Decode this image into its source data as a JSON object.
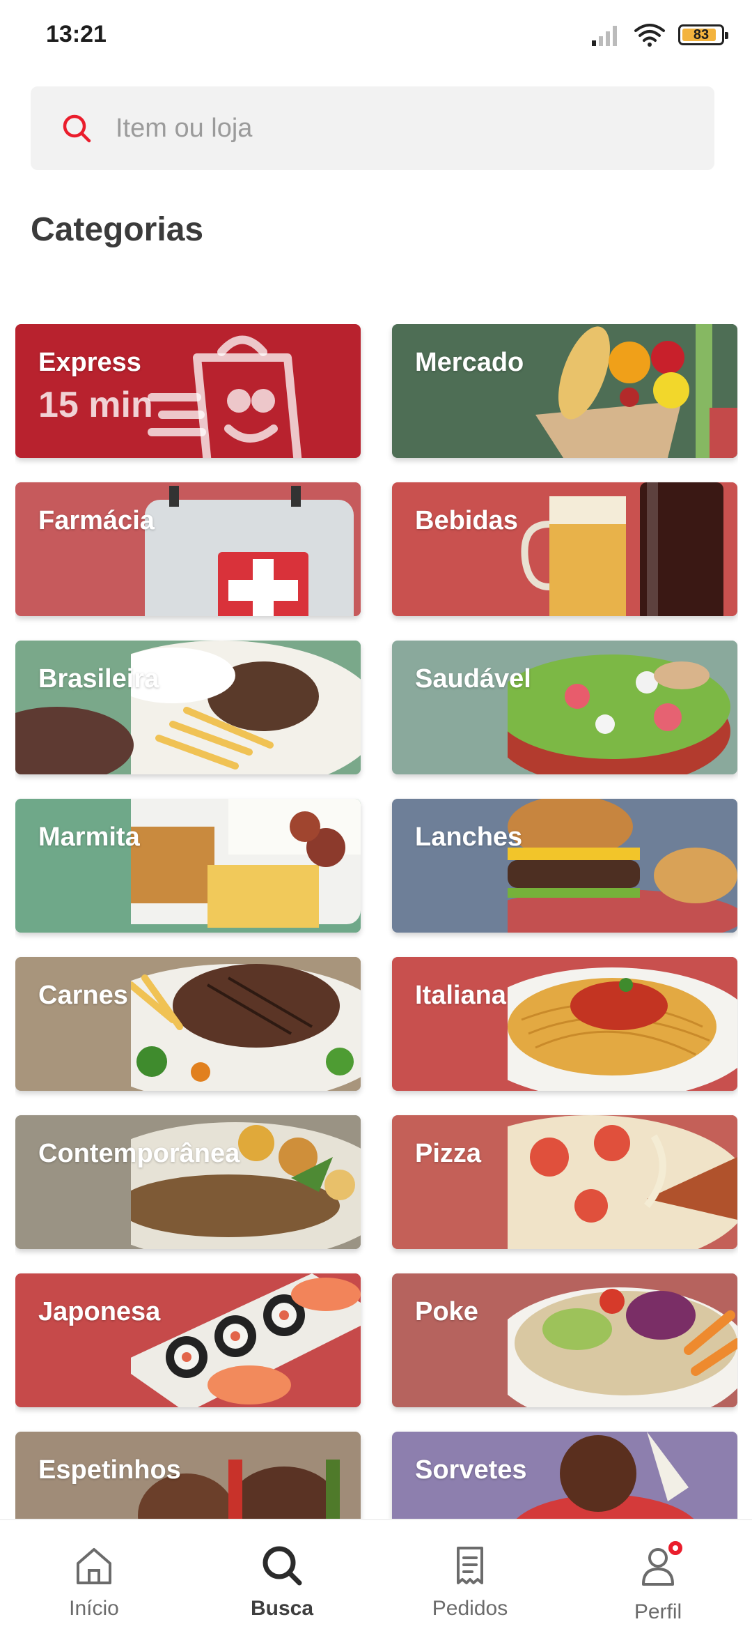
{
  "status_bar": {
    "time": "13:21",
    "battery": "83"
  },
  "search": {
    "placeholder": "Item ou loja",
    "value": ""
  },
  "section_title": "Categorias",
  "categories": [
    {
      "label": "Express",
      "sub": "15 min",
      "color": "#b8222e"
    },
    {
      "label": "Mercado",
      "color": "#4e6e55"
    },
    {
      "label": "Farmácia",
      "color": "#c65a5c"
    },
    {
      "label": "Bebidas",
      "color": "#c9514f"
    },
    {
      "label": "Brasileira",
      "color": "#7aa88a"
    },
    {
      "label": "Saudável",
      "color": "#8aa99c"
    },
    {
      "label": "Marmita",
      "color": "#6fa889"
    },
    {
      "label": "Lanches",
      "color": "#6e7f98"
    },
    {
      "label": "Carnes",
      "color": "#a8957c"
    },
    {
      "label": "Italiana",
      "color": "#c8504e"
    },
    {
      "label": "Contemporânea",
      "color": "#9a9384"
    },
    {
      "label": "Pizza",
      "color": "#c46058"
    },
    {
      "label": "Japonesa",
      "color": "#c64a4a"
    },
    {
      "label": "Poke",
      "color": "#b6635e"
    },
    {
      "label": "Espetinhos",
      "color": "#a08c78"
    },
    {
      "label": "Sorvetes",
      "color": "#8d7fae"
    }
  ],
  "nav": {
    "items": [
      {
        "label": "Início",
        "icon": "home-icon"
      },
      {
        "label": "Busca",
        "icon": "search-icon"
      },
      {
        "label": "Pedidos",
        "icon": "receipt-icon"
      },
      {
        "label": "Perfil",
        "icon": "profile-icon"
      }
    ],
    "active": "Busca",
    "accent": "#ea1d2c"
  }
}
